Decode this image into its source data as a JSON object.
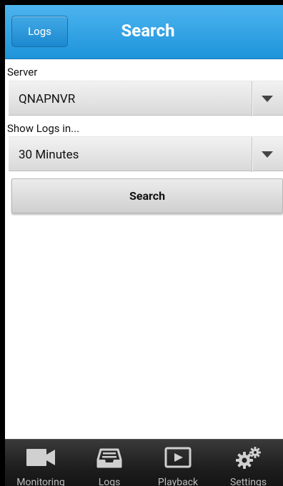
{
  "header": {
    "back_label": "Logs",
    "title": "Search"
  },
  "form": {
    "server_label": "Server",
    "server_value": "QNAPNVR",
    "period_label": "Show Logs in...",
    "period_value": "30 Minutes",
    "search_label": "Search"
  },
  "tabs": [
    {
      "label": "Monitoring",
      "icon": "video-camera-icon"
    },
    {
      "label": "Logs",
      "icon": "inbox-tray-icon"
    },
    {
      "label": "Playback",
      "icon": "play-icon"
    },
    {
      "label": "Settings",
      "icon": "gears-icon"
    }
  ],
  "colors": {
    "header_top": "#4db4ef",
    "header_bottom": "#1d94da",
    "tabbar": "#1e1e1e"
  }
}
